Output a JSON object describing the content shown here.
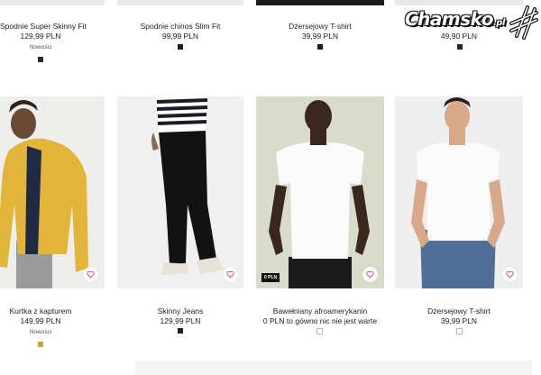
{
  "top_row": [
    {
      "name": "Spodnie Super Skinny Fit",
      "price": "129,99 PLN",
      "badge": "Nowości",
      "swatch": "#2a2a2a"
    },
    {
      "name": "Spodnie chinos Slim Fit",
      "price": "99,99 PLN",
      "swatch": "#1e1e1e"
    },
    {
      "name": "Dżersejowy T-shirt",
      "price": "39,99 PLN",
      "swatch": "#1e1e1e"
    },
    {
      "name": "",
      "price": "49,90 PLN",
      "swatch": "#1e2a44"
    }
  ],
  "bottom_row": [
    {
      "name": "Kurtka z kapturem",
      "price": "149,99 PLN",
      "badge": "Nowości",
      "swatch": "#c9a33a"
    },
    {
      "name": "Skinny Jeans",
      "price": "129,99 PLN",
      "swatch": "#1e1e1e"
    },
    {
      "name": "Bawełniany afroamerykanin",
      "price": "0 PLN to gówno nic nie jest warte",
      "tag": "0 PLN",
      "swatch": "#ffffff"
    },
    {
      "name": "Dżersejowy T-shirt",
      "price": "39,99 PLN",
      "swatch": "#ffffff"
    }
  ],
  "watermark": {
    "brand": "Chamsko",
    "suffix": ".pl"
  },
  "colors": {
    "heart": "#c8466a",
    "tag_bg": "#111111"
  }
}
